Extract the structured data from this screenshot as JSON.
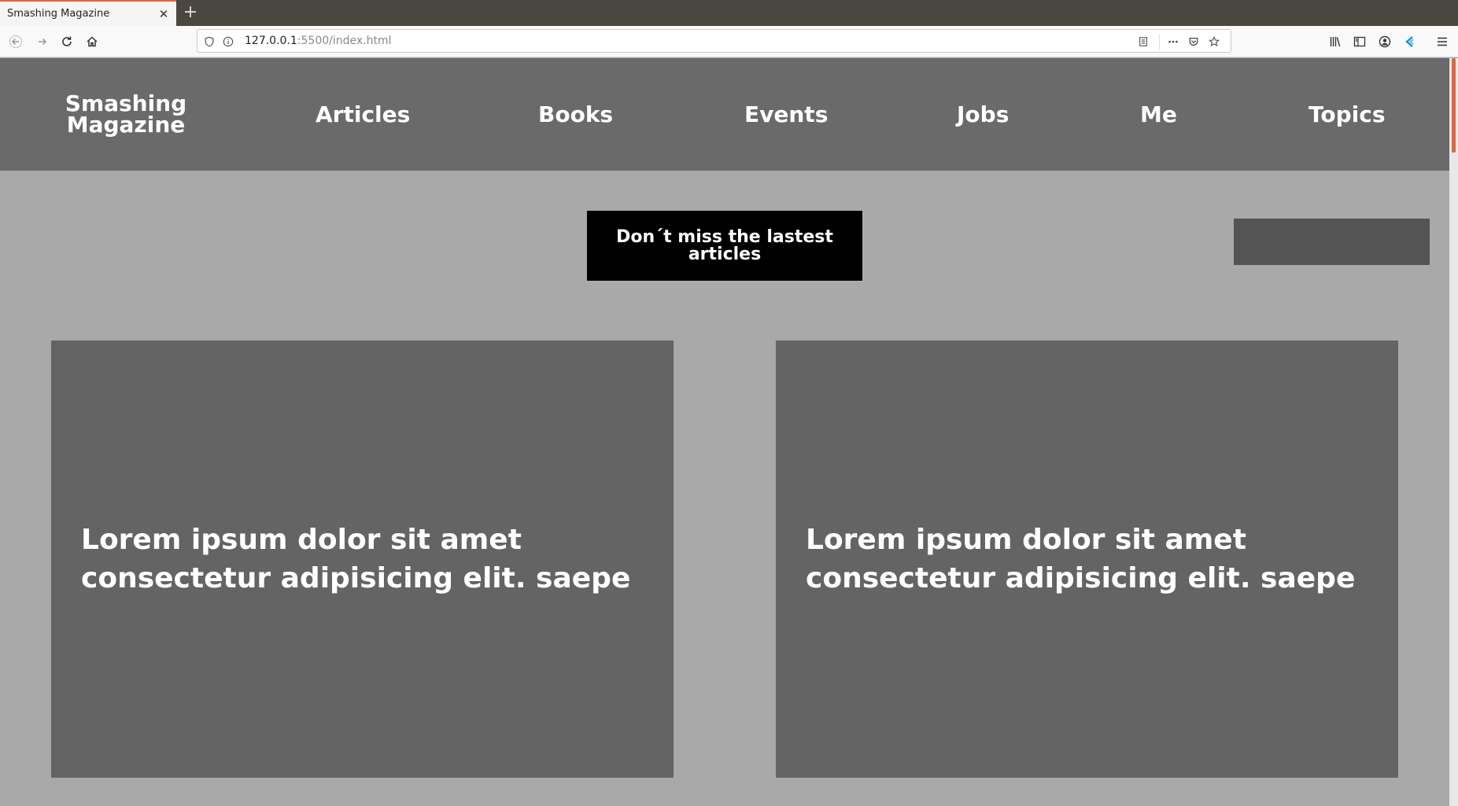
{
  "browser": {
    "tab_title": "Smashing Magazine",
    "tab_close_glyph": "✕",
    "new_tab_glyph": "+",
    "url_host": "127.0.0.1",
    "url_rest": ":5500/index.html",
    "accent_color": "#e2673c"
  },
  "site": {
    "logo_line1": "Smashing",
    "logo_line2": "Magazine",
    "menu": [
      "Articles",
      "Books",
      "Events",
      "Jobs",
      "Me",
      "Topics"
    ],
    "cta_label": "Don´t miss the lastest articles",
    "cards": [
      {
        "title": "Lorem ipsum dolor sit amet consectetur adipisicing elit. saepe"
      },
      {
        "title": "Lorem ipsum dolor sit amet consectetur adipisicing elit. saepe"
      }
    ],
    "colors": {
      "page_bg": "#a9a9a9",
      "header_bg": "#6a6a6a",
      "card_bg": "#646464",
      "cta_bg": "#000000",
      "side_box_bg": "#545454"
    }
  },
  "icons": {
    "back": "back-arrow-icon",
    "forward": "forward-arrow-icon",
    "reload": "reload-icon",
    "home": "home-icon",
    "shield": "tracking-shield-icon",
    "info": "site-info-icon",
    "reader": "reader-view-icon",
    "more": "page-actions-more-icon",
    "pocket": "pocket-icon",
    "bookmark": "bookmark-star-icon",
    "library": "library-icon",
    "sidebar": "sidebar-icon",
    "account": "account-icon",
    "extension": "extension-icon",
    "menu": "hamburger-menu-icon"
  }
}
